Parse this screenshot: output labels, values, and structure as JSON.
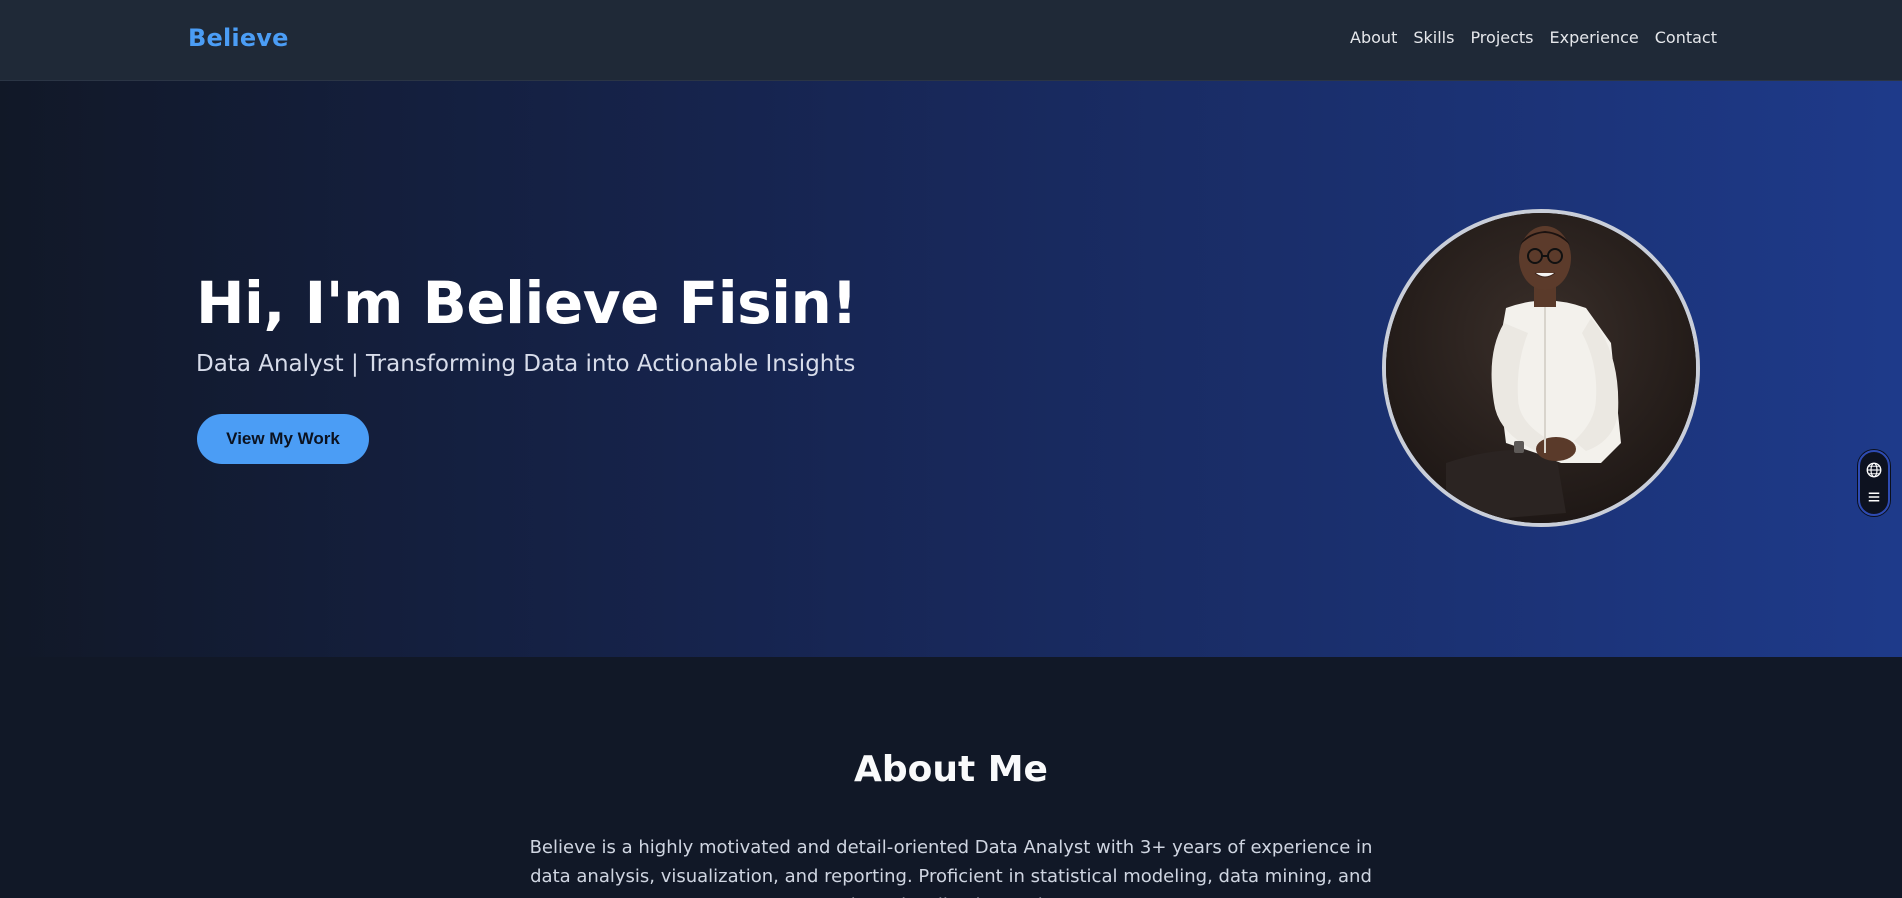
{
  "navbar": {
    "brand": "Believe",
    "links": [
      {
        "label": "About"
      },
      {
        "label": "Skills"
      },
      {
        "label": "Projects"
      },
      {
        "label": "Experience"
      },
      {
        "label": "Contact"
      }
    ]
  },
  "hero": {
    "title": "Hi, I'm Believe Fisin!",
    "subtitle": "Data Analyst | Transforming Data into Actionable Insights",
    "cta_label": "View My Work",
    "avatar_alt": "profile-photo"
  },
  "widget": {
    "icons": [
      "globe-icon",
      "menu-icon"
    ]
  },
  "about": {
    "title": "About Me",
    "text": "Believe is a highly motivated and detail-oriented Data Analyst with 3+ years of experience in data analysis, visualization, and reporting. Proficient in statistical modeling, data mining, and data visualization tools."
  },
  "colors": {
    "accent": "#4b9df5",
    "navbar_bg": "#1f2937",
    "page_bg": "#111827",
    "hero_gradient_start": "#111827",
    "hero_gradient_end": "#1e3a8a"
  }
}
